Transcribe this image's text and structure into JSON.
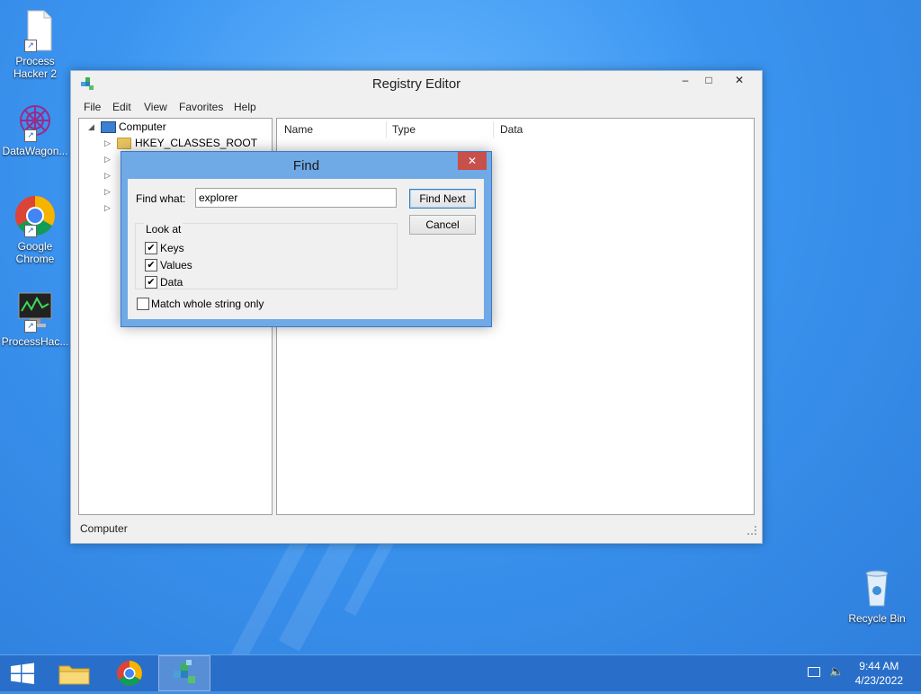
{
  "desktop": {
    "icons": [
      {
        "label": "Process\nHacker 2"
      },
      {
        "label": "DataWagon..."
      },
      {
        "label": "Google\nChrome"
      },
      {
        "label": "ProcessHac..."
      },
      {
        "label": "Recycle Bin"
      }
    ]
  },
  "window": {
    "title": "Registry Editor",
    "controls": {
      "minimize": "–",
      "maximize": "□",
      "close": "✕"
    },
    "menu": [
      "File",
      "Edit",
      "View",
      "Favorites",
      "Help"
    ],
    "tree": {
      "root": "Computer",
      "first_child": "HKEY_CLASSES_ROOT"
    },
    "columns": [
      "Name",
      "Type",
      "Data"
    ],
    "status": "Computer"
  },
  "find": {
    "title": "Find",
    "close": "✕",
    "find_what_label": "Find what:",
    "find_what_value": "explorer",
    "find_next": "Find Next",
    "cancel": "Cancel",
    "look_at_label": "Look at",
    "options": [
      {
        "label": "Keys",
        "checked": "✔"
      },
      {
        "label": "Values",
        "checked": "✔"
      },
      {
        "label": "Data",
        "checked": "✔"
      }
    ],
    "match_whole": {
      "label": "Match whole string only",
      "checked": ""
    }
  },
  "taskbar": {
    "time": "9:44 AM",
    "date": "4/23/2022"
  },
  "colors": {
    "accent": "#3b95f0",
    "taskbar": "#286ec8",
    "close_red": "#c7504a"
  }
}
